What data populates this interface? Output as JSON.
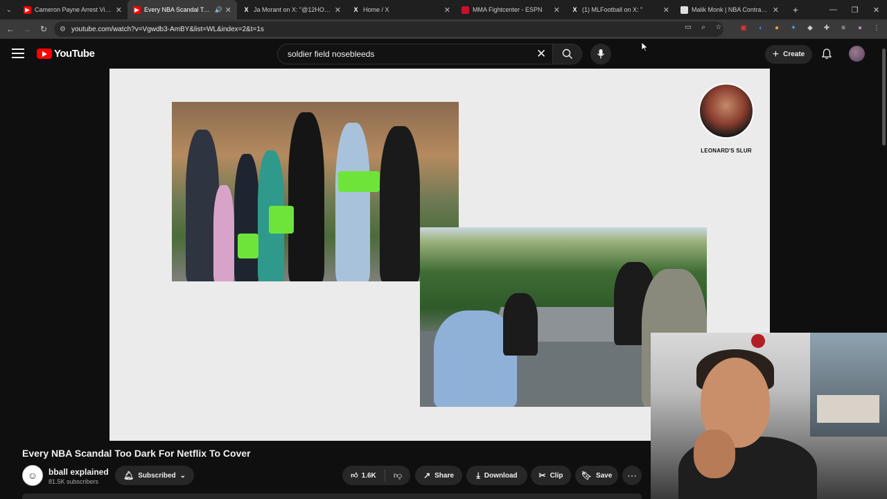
{
  "browser": {
    "tabs": [
      {
        "title": "Cameron Payne Arrest Video S",
        "favicon": "youtube-icon",
        "active": false
      },
      {
        "title": "Every NBA Scandal Too Dar",
        "favicon": "youtube-icon",
        "active": true,
        "audio": true
      },
      {
        "title": "Ja Morant on X: \"@12HOOPJA",
        "favicon": "x-icon",
        "active": false
      },
      {
        "title": "Home / X",
        "favicon": "x-icon",
        "active": false
      },
      {
        "title": "MMA Fightcenter - ESPN",
        "favicon": "espn-icon",
        "active": false
      },
      {
        "title": "(1) MLFootball on X: \"",
        "favicon": "x-icon",
        "active": false
      },
      {
        "title": "Malik Monk | NBA Contracts &",
        "favicon": "spotrac-icon",
        "active": false
      }
    ],
    "url": "youtube.com/watch?v=Vgwdb3-AmBY&list=WL&index=2&t=1s"
  },
  "youtube": {
    "logo_text": "YouTube",
    "search_query": "soldier field nosebleeds",
    "create_label": "Create"
  },
  "player": {
    "badge_label": "LEONARD'S SLUR"
  },
  "video": {
    "title": "Every NBA Scandal Too Dark For Netflix To Cover",
    "channel_name": "bball explained",
    "subscribers": "81.5K subscribers",
    "subscribed_label": "Subscribed",
    "like_count": "1.6K",
    "share_label": "Share",
    "download_label": "Download",
    "clip_label": "Clip",
    "save_label": "Save"
  },
  "colors": {
    "youtube_red": "#ff0000",
    "background": "#0f0f0f",
    "chip": "#272727"
  }
}
